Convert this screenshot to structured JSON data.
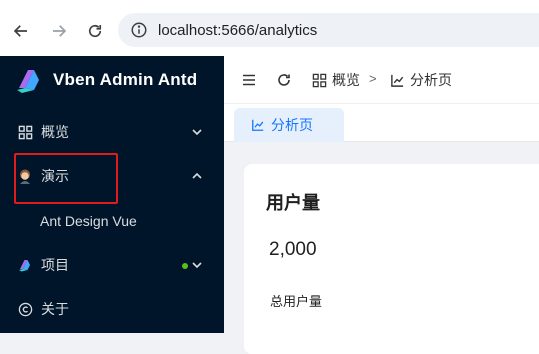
{
  "browser": {
    "url": "localhost:5666/analytics",
    "back_icon": "arrow-left-icon",
    "forward_icon": "arrow-right-icon",
    "reload_icon": "reload-icon",
    "info_icon": "info-icon"
  },
  "sidebar": {
    "brand": "Vben Admin Antd",
    "items": [
      {
        "label": "概览",
        "icon": "dashboard-grid-icon",
        "arrow": "chevron-down-icon"
      },
      {
        "label": "演示",
        "icon": "avatar-icon",
        "arrow": "chevron-up-icon"
      },
      {
        "label": "Ant Design Vue"
      },
      {
        "label": "项目",
        "icon": "vben-logo-icon",
        "arrow": "chevron-down-icon",
        "badge_color": "#52c41a"
      },
      {
        "label": "关于",
        "icon": "copyright-icon"
      }
    ]
  },
  "header": {
    "breadcrumbs": [
      {
        "label": "概览",
        "icon": "dashboard-grid-icon"
      },
      {
        "label": "分析页",
        "icon": "chart-icon"
      }
    ]
  },
  "tabs": [
    {
      "label": "分析页",
      "icon": "chart-icon",
      "active": true
    }
  ],
  "card": {
    "title": "用户量",
    "value": "2,000",
    "footer": "总用户量"
  },
  "colors": {
    "sidebar_bg": "#001529",
    "accent": "#1677ff",
    "highlight": "#e01c1c"
  }
}
